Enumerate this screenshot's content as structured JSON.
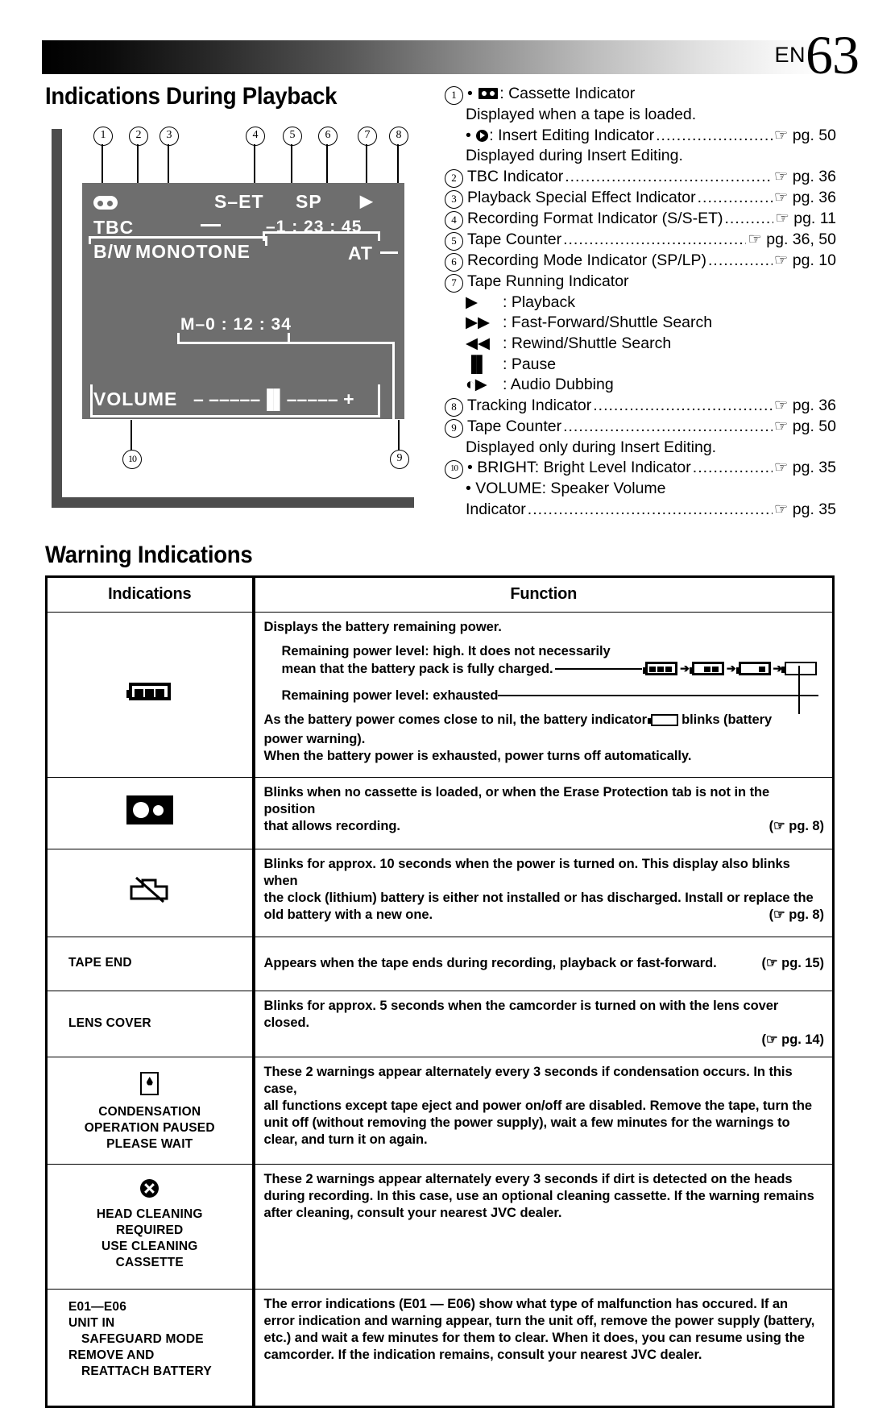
{
  "header": {
    "page_prefix": "EN",
    "page_number": "63"
  },
  "sections": {
    "playback_title": "Indications During Playback",
    "warning_title": "Warning Indications"
  },
  "lcd": {
    "callouts": [
      "1",
      "2",
      "3",
      "4",
      "5",
      "6",
      "7",
      "8",
      "9",
      "10"
    ],
    "osd": {
      "cassette_icon": "cassette-icon",
      "format": "S–ET",
      "mode": "SP",
      "play_icon": "▶",
      "tbc": "TBC",
      "counter": "–1 : 23 : 45",
      "bw": "B/W",
      "monotone": "MONOTONE",
      "tracking": "AT",
      "memory_counter": "M–0 : 12 : 34",
      "volume_label": "VOLUME",
      "volume_bar": "–  –––––▐▌–––––  +"
    }
  },
  "legend": [
    {
      "num": "1",
      "bullet": true,
      "icon": "cassette-icon",
      "label": ": Cassette Indicator",
      "dots": false,
      "page": ""
    },
    {
      "num": "",
      "indent": 1,
      "label": "Displayed when a tape is loaded.",
      "dots": false,
      "page": ""
    },
    {
      "num": "",
      "indent": 1,
      "bullet": true,
      "icon": "insert-edit-icon",
      "label": ": Insert Editing Indicator",
      "dots": true,
      "page": "☞ pg. 50"
    },
    {
      "num": "",
      "indent": 1,
      "label": "Displayed during Insert Editing.",
      "dots": false,
      "page": ""
    },
    {
      "num": "2",
      "label": "TBC Indicator",
      "dots": true,
      "page": "☞ pg. 36"
    },
    {
      "num": "3",
      "label": "Playback Special Effect Indicator",
      "dots": true,
      "page": "☞ pg. 36"
    },
    {
      "num": "4",
      "label": "Recording Format Indicator (S/S-ET)",
      "dots": true,
      "page": "☞ pg. 11"
    },
    {
      "num": "5",
      "label": "Tape Counter",
      "dots": true,
      "page": "☞ pg. 36, 50"
    },
    {
      "num": "6",
      "label": "Recording Mode Indicator (SP/LP)",
      "dots": true,
      "page": "☞ pg. 10"
    },
    {
      "num": "7",
      "label": "Tape Running Indicator",
      "dots": false,
      "page": ""
    },
    {
      "num": "",
      "indent": 1,
      "glyph": "▶",
      "label": ": Playback",
      "dots": false,
      "page": ""
    },
    {
      "num": "",
      "indent": 1,
      "glyph": "▶▶",
      "label": ": Fast-Forward/Shuttle Search",
      "dots": false,
      "page": ""
    },
    {
      "num": "",
      "indent": 1,
      "glyph": "◀◀",
      "label": ": Rewind/Shuttle Search",
      "dots": false,
      "page": ""
    },
    {
      "num": "",
      "indent": 1,
      "glyph": "▐▌",
      "label": ": Pause",
      "dots": false,
      "page": ""
    },
    {
      "num": "",
      "indent": 1,
      "glyph": "◐▶",
      "label": ": Audio Dubbing",
      "dots": false,
      "page": ""
    },
    {
      "num": "8",
      "label": "Tracking Indicator",
      "dots": true,
      "page": "☞ pg. 36"
    },
    {
      "num": "9",
      "label": "Tape Counter",
      "dots": true,
      "page": "☞ pg. 50"
    },
    {
      "num": "",
      "indent": 1,
      "label": "Displayed only during Insert Editing.",
      "dots": false,
      "page": ""
    },
    {
      "num": "10",
      "bullet": true,
      "label": "BRIGHT: Bright Level Indicator",
      "dots": true,
      "page": "☞ pg. 35"
    },
    {
      "num": "",
      "indent": 1,
      "bullet": true,
      "label": "VOLUME: Speaker Volume",
      "dots": false,
      "page": ""
    },
    {
      "num": "",
      "indent": 1,
      "label": "Indicator",
      "dots": true,
      "page": "☞ pg. 35"
    }
  ],
  "table": {
    "headers": {
      "indications": "Indications",
      "function": "Function"
    },
    "rows": [
      {
        "icon": "battery-full-icon",
        "labels": [],
        "function_lines": [
          "Displays the battery remaining power.",
          "Remaining power level: high. It does not necessarily",
          "mean that the battery pack is fully charged.",
          "Remaining power level: exhausted",
          "As the battery power comes close to nil, the battery indicator",
          "blinks (battery",
          "power warning).",
          "When the battery power is exhausted, power turns off automatically."
        ],
        "page": ""
      },
      {
        "icon": "cassette-warning-icon",
        "labels": [],
        "function_lines": [
          "Blinks when no cassette is loaded, or when the Erase Protection tab is not in the position",
          "that allows recording."
        ],
        "page": "(☞ pg. 8)"
      },
      {
        "icon": "lithium-battery-icon",
        "labels": [],
        "function_lines": [
          "Blinks for approx. 10 seconds when the power is turned on. This display also blinks when",
          "the clock (lithium) battery is either not installed or has discharged. Install or replace the",
          "old battery with a new one."
        ],
        "page": "(☞ pg. 8)"
      },
      {
        "icon": "",
        "labels": [
          "TAPE END"
        ],
        "function_lines": [
          "Appears when the tape ends during recording, playback or fast-forward."
        ],
        "page": "(☞ pg. 15)"
      },
      {
        "icon": "",
        "labels": [
          "LENS COVER"
        ],
        "function_lines": [
          "Blinks for approx. 5 seconds when the camcorder is turned on with the lens cover closed."
        ],
        "page": "(☞ pg. 14)"
      },
      {
        "icon": "condensation-icon",
        "labels": [
          "CONDENSATION",
          "OPERATION PAUSED",
          "PLEASE WAIT"
        ],
        "function_lines": [
          "These 2 warnings appear alternately every 3 seconds if condensation occurs. In this case,",
          "all functions except tape eject and power on/off are disabled. Remove the tape, turn the",
          "unit off (without removing the power supply), wait a few minutes for the warnings to",
          "clear, and turn it on again."
        ],
        "page": ""
      },
      {
        "icon": "head-cleaning-icon",
        "labels": [
          "HEAD CLEANING",
          "REQUIRED",
          "USE CLEANING",
          "CASSETTE"
        ],
        "function_lines": [
          "These 2 warnings appear alternately every 3 seconds if dirt is detected on the heads",
          "during recording. In this case, use an optional cleaning cassette. If the warning remains",
          "after cleaning, consult your nearest JVC dealer."
        ],
        "page": ""
      },
      {
        "icon": "",
        "labels": [
          "E01—E06",
          "UNIT IN",
          "SAFEGUARD MODE",
          "REMOVE AND",
          "REATTACH BATTERY"
        ],
        "function_lines": [
          "The error indications (E01 — E06) show what type of malfunction has occured. If an",
          "error indication and warning appear, turn the unit off, remove the power supply (battery,",
          "etc.) and wait a few minutes for them to clear. When it does, you can resume using the",
          "camcorder. If the indication remains, consult your nearest JVC dealer."
        ],
        "page": ""
      }
    ]
  }
}
